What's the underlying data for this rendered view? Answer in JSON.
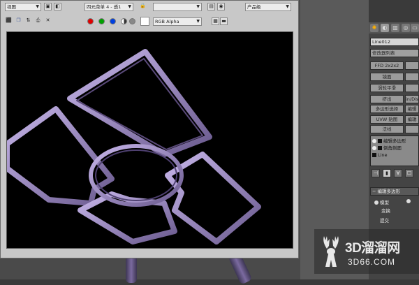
{
  "toolbar1": {
    "view_dropdown": "视图",
    "menu_dropdown": "四元菜单 4 - 透1",
    "lock_icon": "lock-icon",
    "line_dropdown": "",
    "product_dropdown": "产品级"
  },
  "toolbar2": {
    "channel_dropdown": "RGB Alpha",
    "colors": {
      "red": "#e00000",
      "green": "#00a000",
      "blue": "#0040e0"
    }
  },
  "command_panel": {
    "object_name": "Line012",
    "modifier_list": "修改器列表",
    "buttons": [
      "FFD 2x2x2",
      "",
      "镜面",
      "",
      "涡轮平滑",
      "",
      "挤出",
      "in/Dis",
      "多边形选择",
      "编辑",
      "UVW 贴图",
      "编辑",
      "法线",
      ""
    ],
    "stack_items": [
      "编辑多边形",
      "倒角剖面",
      "Line"
    ],
    "rollout_title": "编辑多边形",
    "mode_label": "模型",
    "transform_label": "变换",
    "commit_label": "提交"
  },
  "watermark": {
    "brand": "3D溜溜网",
    "domain": "3D66.COM"
  },
  "accent": "#9b86c8"
}
